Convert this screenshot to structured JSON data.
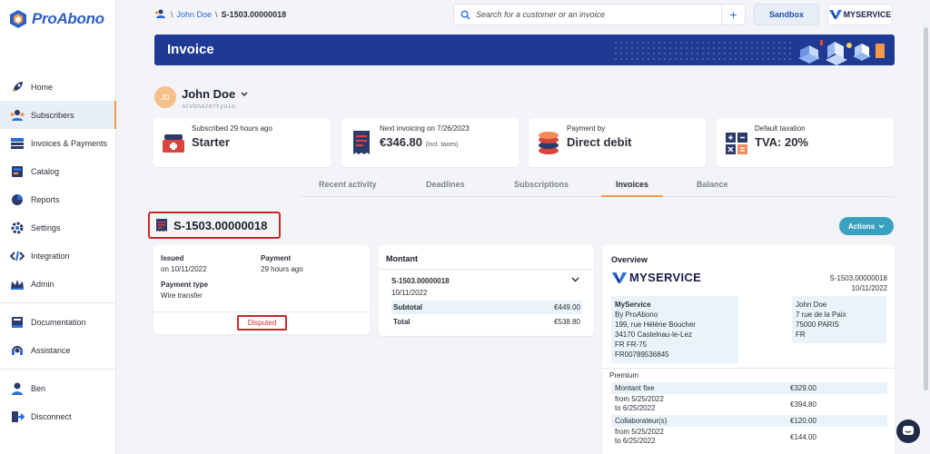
{
  "app": {
    "name": "ProAbono",
    "brand_color": "#2a5fc7",
    "accent_color": "#f2994a"
  },
  "sidebar": {
    "items": [
      {
        "label": "Home",
        "icon": "rocket-icon"
      },
      {
        "label": "Subscribers",
        "icon": "subscribers-icon",
        "active": true
      },
      {
        "label": "Invoices & Payments",
        "icon": "invoices-icon"
      },
      {
        "label": "Catalog",
        "icon": "catalog-icon"
      },
      {
        "label": "Reports",
        "icon": "pie-chart-icon"
      },
      {
        "label": "Settings",
        "icon": "gear-icon"
      },
      {
        "label": "Integration",
        "icon": "code-icon"
      },
      {
        "label": "Admin",
        "icon": "crown-icon"
      }
    ],
    "help_items": [
      {
        "label": "Documentation",
        "icon": "book-icon"
      },
      {
        "label": "Assistance",
        "icon": "headset-icon"
      }
    ],
    "user_items": [
      {
        "label": "Ben",
        "icon": "user-icon"
      },
      {
        "label": "Disconnect",
        "icon": "logout-icon"
      }
    ]
  },
  "header": {
    "breadcrumb": {
      "customer": "John Doe",
      "invoice": "S-1503.00000018"
    },
    "search_placeholder": "Search for a customer or an invoice",
    "sandbox_label": "Sandbox",
    "business_name": "MYSERVICE"
  },
  "banner": {
    "title": "Invoice",
    "color": "#1e3a92"
  },
  "customer": {
    "initials": "JD",
    "name": "John Doe",
    "id": "acvbnazertyuio"
  },
  "stats": [
    {
      "label": "Subscribed 29 hours ago",
      "value": "Starter",
      "icon": "starter-icon"
    },
    {
      "label": "Next invoicing on 7/26/2023",
      "value": "€346.80",
      "suffix": "(incl. taxes)",
      "icon": "receipt-icon"
    },
    {
      "label": "Payment by",
      "value": "Direct debit",
      "icon": "coins-icon"
    },
    {
      "label": "Default taxation",
      "value": "TVA: 20%",
      "icon": "calculator-icon"
    }
  ],
  "tabs": [
    {
      "label": "Recent activity"
    },
    {
      "label": "Deadlines"
    },
    {
      "label": "Subscriptions"
    },
    {
      "label": "Invoices",
      "active": true
    },
    {
      "label": "Balance"
    }
  ],
  "invoice": {
    "number": "S-1503.00000018",
    "actions_label": "Actions",
    "issued_label": "Issued",
    "issued_value": "on 10/11/2022",
    "payment_label": "Payment",
    "payment_value": "29 hours ago",
    "payment_type_label": "Payment type",
    "payment_type_value": "Wire transfer",
    "status": "Disputed",
    "status_color": "#d32f2f"
  },
  "montant": {
    "title": "Montant",
    "invoice_id": "S-1503.00000018",
    "date": "10/11/2022",
    "subtotal_label": "Subtotal",
    "subtotal_value": "€449.00",
    "total_label": "Total",
    "total_value": "€538.80"
  },
  "overview": {
    "title": "Overview",
    "brand": "MYSERVICE",
    "invoice_id": "S-1503.00000018",
    "date": "10/11/2022",
    "seller": {
      "name": "MyService",
      "line1": "By ProAbono",
      "line2": "199, rue Hélène Boucher",
      "line3": "34170   Castelnau-le-Lez",
      "line4": "FR   FR-75",
      "line5": "FR00789536845"
    },
    "buyer": {
      "name": "John Doe",
      "line1": "7 rue de la Paix",
      "line2": "75000   PARIS",
      "line3": "FR"
    },
    "section": "Premium",
    "rows": [
      {
        "label": "Montant fixe",
        "value": "€329.00"
      },
      {
        "label": "from 5/25/2022",
        "label2": "to 6/25/2022",
        "value": "€394.80"
      },
      {
        "label": "Collaborateur(s)",
        "value": "€120.00"
      },
      {
        "label": "from 5/25/2022",
        "label2": "to 6/25/2022",
        "value": "€144.00"
      }
    ]
  }
}
